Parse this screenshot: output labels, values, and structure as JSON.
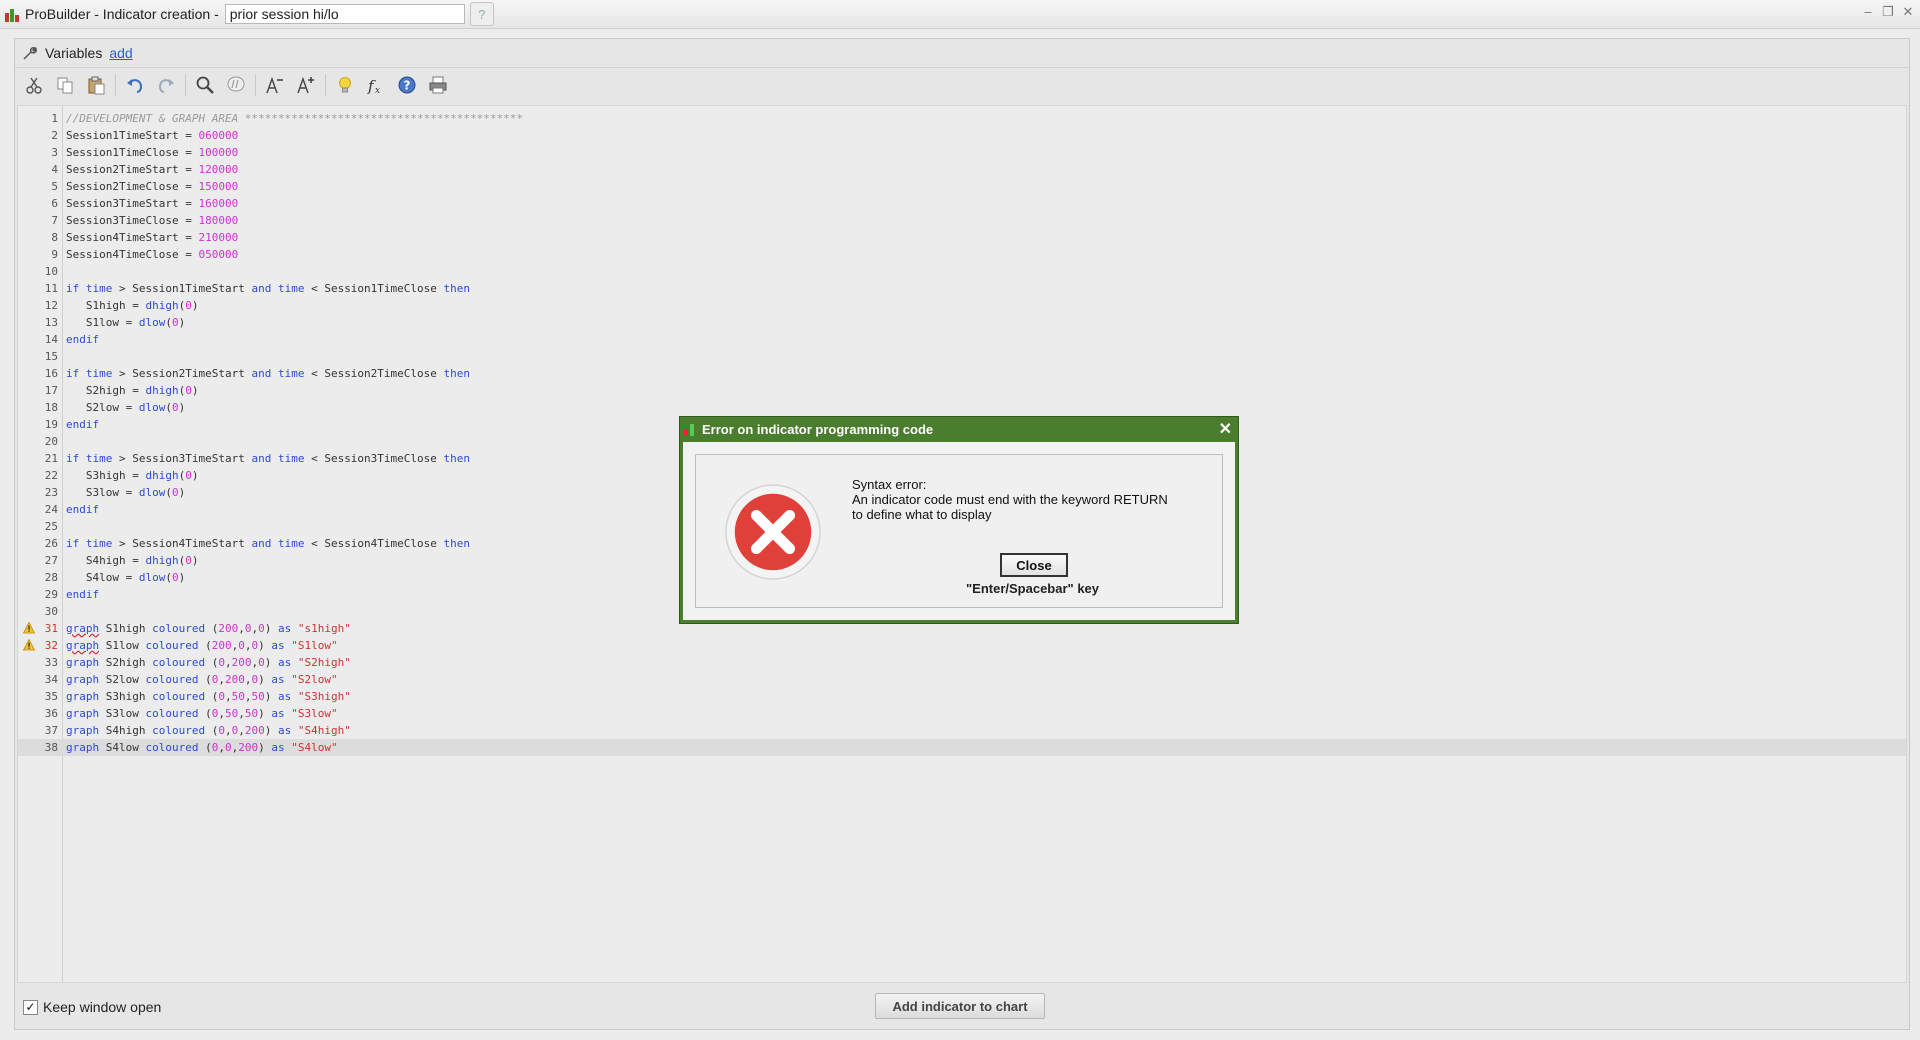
{
  "window": {
    "title": "ProBuilder - Indicator creation -",
    "indicator_name": "prior session hi/lo",
    "help_symbol": "?",
    "controls": {
      "minimize": "–",
      "restore": "❐",
      "close": "✕"
    }
  },
  "variables": {
    "label": "Variables",
    "add_link": "add"
  },
  "toolbar": {
    "buttons": [
      "cut-icon",
      "copy-icon",
      "paste-icon",
      "undo-icon",
      "redo-icon",
      "search-icon",
      "comment-icon",
      "decrease-font-icon",
      "increase-font-icon",
      "lightbulb-icon",
      "function-icon",
      "help-icon",
      "print-icon"
    ]
  },
  "editor": {
    "lines": [
      {
        "n": "1",
        "code": "//DEVELOPMENT & GRAPH AREA ******************************************"
      },
      {
        "n": "2",
        "code": "Session1TimeStart = 060000"
      },
      {
        "n": "3",
        "code": "Session1TimeClose = 100000"
      },
      {
        "n": "4",
        "code": "Session2TimeStart = 120000"
      },
      {
        "n": "5",
        "code": "Session2TimeClose = 150000"
      },
      {
        "n": "6",
        "code": "Session3TimeStart = 160000"
      },
      {
        "n": "7",
        "code": "Session3TimeClose = 180000"
      },
      {
        "n": "8",
        "code": "Session4TimeStart = 210000"
      },
      {
        "n": "9",
        "code": "Session4TimeClose = 050000"
      },
      {
        "n": "10",
        "code": ""
      },
      {
        "n": "11",
        "code": "if time > Session1TimeStart and time < Session1TimeClose then"
      },
      {
        "n": "12",
        "code": "   S1high = dhigh(0)"
      },
      {
        "n": "13",
        "code": "   S1low = dlow(0)"
      },
      {
        "n": "14",
        "code": "endif"
      },
      {
        "n": "15",
        "code": ""
      },
      {
        "n": "16",
        "code": "if time > Session2TimeStart and time < Session2TimeClose then"
      },
      {
        "n": "17",
        "code": "   S2high = dhigh(0)"
      },
      {
        "n": "18",
        "code": "   S2low = dlow(0)"
      },
      {
        "n": "19",
        "code": "endif"
      },
      {
        "n": "20",
        "code": ""
      },
      {
        "n": "21",
        "code": "if time > Session3TimeStart and time < Session3TimeClose then"
      },
      {
        "n": "22",
        "code": "   S3high = dhigh(0)"
      },
      {
        "n": "23",
        "code": "   S3low = dlow(0)"
      },
      {
        "n": "24",
        "code": "endif"
      },
      {
        "n": "25",
        "code": ""
      },
      {
        "n": "26",
        "code": "if time > Session4TimeStart and time < Session4TimeClose then"
      },
      {
        "n": "27",
        "code": "   S4high = dhigh(0)"
      },
      {
        "n": "28",
        "code": "   S4low = dlow(0)"
      },
      {
        "n": "29",
        "code": "endif"
      },
      {
        "n": "30",
        "code": ""
      },
      {
        "n": "31",
        "code": "graph S1high coloured (200,0,0) as \"s1high\"",
        "warn": true
      },
      {
        "n": "32",
        "code": "graph S1low coloured (200,0,0) as \"S1low\"",
        "warn": true
      },
      {
        "n": "33",
        "code": "graph S2high coloured (0,200,0) as \"S2high\""
      },
      {
        "n": "34",
        "code": "graph S2low coloured (0,200,0) as \"S2low\""
      },
      {
        "n": "35",
        "code": "graph S3high coloured (0,50,50) as \"S3high\""
      },
      {
        "n": "36",
        "code": "graph S3low coloured (0,50,50) as \"S3low\""
      },
      {
        "n": "37",
        "code": "graph S4high coloured (0,0,200) as \"S4high\""
      },
      {
        "n": "38",
        "code": "graph S4low coloured (0,0,200) as \"S4low\"",
        "current": true
      }
    ]
  },
  "footer": {
    "keep_open_label": "Keep window open",
    "keep_open_checked": true,
    "add_button": "Add indicator to chart"
  },
  "dialog": {
    "title": "Error on indicator programming code",
    "close_x": "✕",
    "heading": "Syntax error:",
    "message_line1": "An indicator code must end with the keyword RETURN",
    "message_line2": "to define what to display",
    "close_button": "Close",
    "key_hint": "\"Enter/Spacebar\" key"
  },
  "colors": {
    "keyword": "#2c4bd0",
    "number": "#cc33cc",
    "string": "#cc3333",
    "comment": "#9a9a9a",
    "dialog_frame": "#4a7d2e",
    "error_red": "#e0403a"
  }
}
